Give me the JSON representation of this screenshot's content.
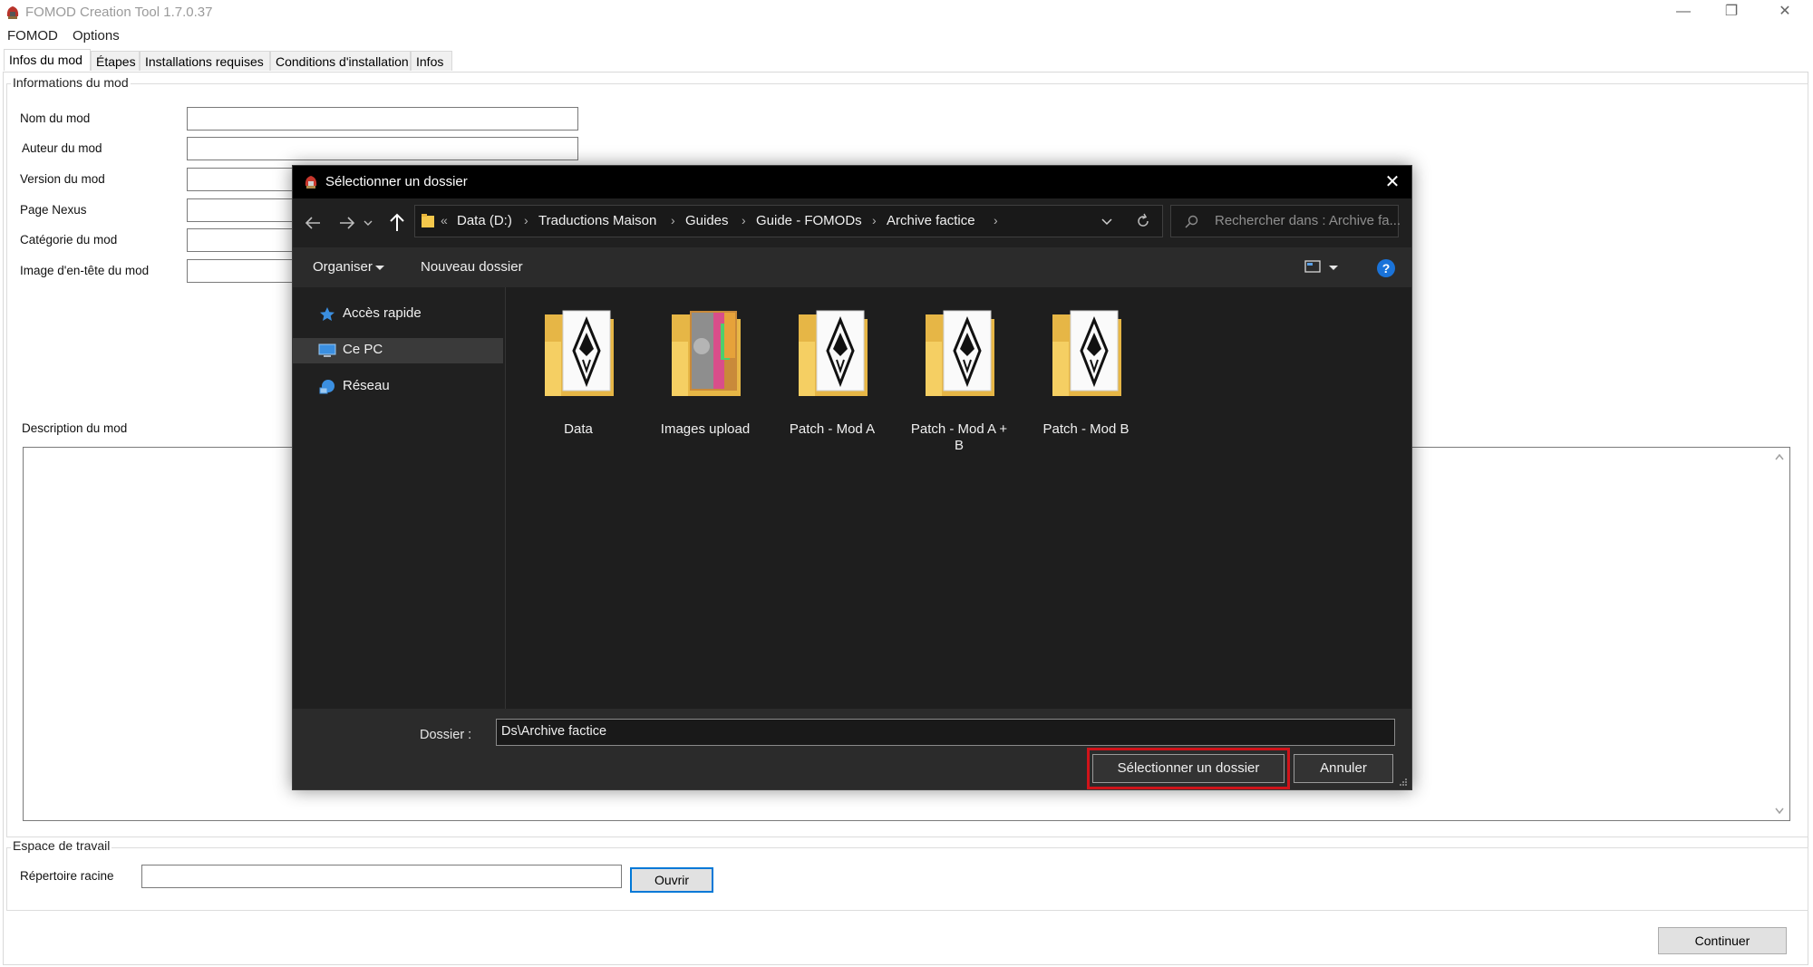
{
  "window": {
    "title": "FOMOD Creation Tool 1.7.0.37",
    "controls": {
      "minimize": "—",
      "restore": "❐",
      "close": "✕"
    }
  },
  "menu": [
    "FOMOD",
    "Options"
  ],
  "tabs": [
    "Infos du mod",
    "Étapes",
    "Installations requises",
    "Conditions d'installation",
    "Infos"
  ],
  "mod_info": {
    "caption": "Informations du mod",
    "fields": [
      "Nom du mod",
      "Auteur du mod",
      "Version du mod",
      "Page Nexus",
      "Catégorie du mod",
      "Image d'en-tête du mod"
    ],
    "description_label": "Description du mod"
  },
  "workspace": {
    "caption": "Espace de travail",
    "root_label": "Répertoire racine",
    "open_button": "Ouvrir"
  },
  "continue_button": "Continuer",
  "dialog": {
    "title": "Sélectionner un dossier",
    "breadcrumb": {
      "overflow": "«",
      "items": [
        "Data (D:)",
        "Traductions Maison",
        "Guides",
        "Guide - FOMODs",
        "Archive factice"
      ]
    },
    "search_placeholder": "Rechercher dans : Archive fa...",
    "organize": "Organiser",
    "new_folder": "Nouveau dossier",
    "help": "?",
    "nav": [
      "Accès rapide",
      "Ce PC",
      "Réseau"
    ],
    "selected_nav": "Ce PC",
    "folders": [
      {
        "name": "Data",
        "icon": "skyrim-folder-icon"
      },
      {
        "name": "Images upload",
        "icon": "image-folder-icon"
      },
      {
        "name": "Patch - Mod A",
        "icon": "skyrim-folder-icon"
      },
      {
        "name": "Patch - Mod A + B",
        "icon": "skyrim-folder-icon"
      },
      {
        "name": "Patch - Mod B",
        "icon": "skyrim-folder-icon"
      }
    ],
    "folder_field_label": "Dossier :",
    "folder_field_value": "Ds\\Archive factice",
    "select_button": "Sélectionner un dossier",
    "cancel_button": "Annuler",
    "colors": {
      "highlight": "#d0141a",
      "background": "#202020"
    }
  }
}
